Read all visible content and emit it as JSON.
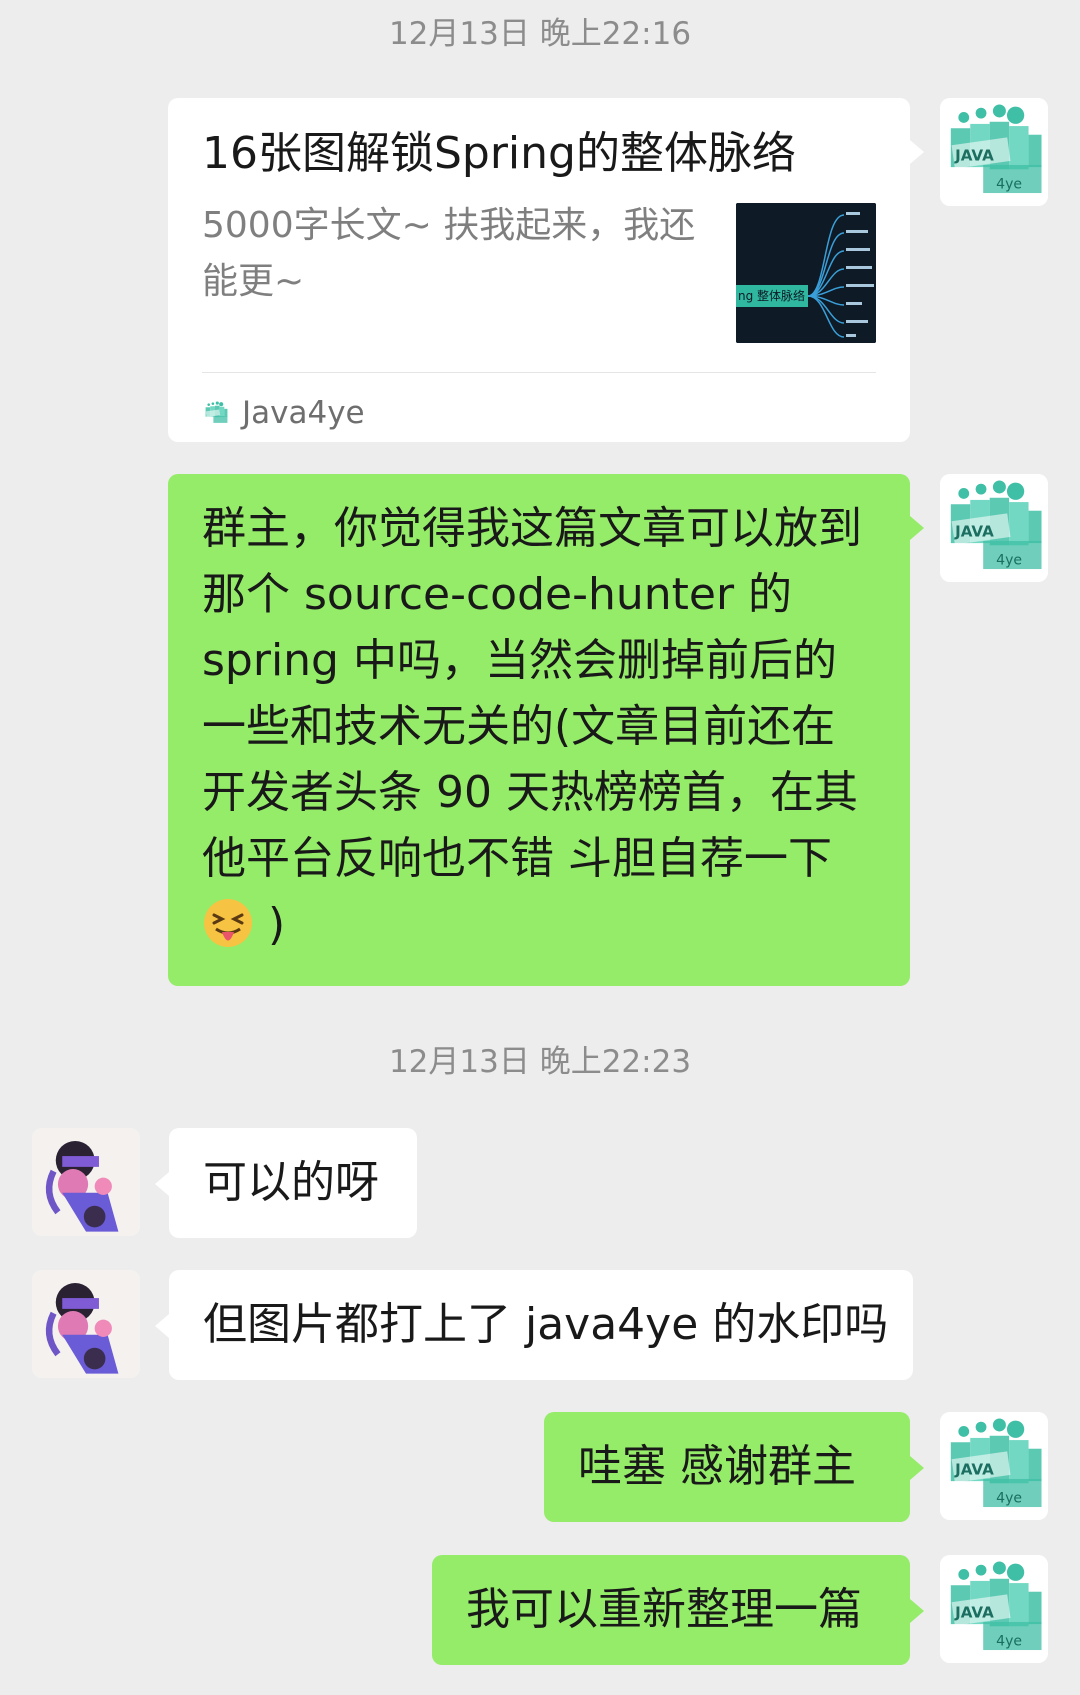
{
  "timestamps": [
    "12月13日 晚上22:16",
    "12月13日 晚上22:23"
  ],
  "link_card": {
    "title": "16张图解锁Spring的整体脉络",
    "description": "5000字长文~ 扶我起来，我还能更~",
    "thumbnail_label": "ng 整体脉络",
    "source": "Java4ye"
  },
  "self_avatar_text": {
    "line1": "JAVA",
    "line2": "4ye"
  },
  "messages": [
    {
      "sender": "self",
      "text_before_emoji": "群主，你觉得我这篇文章可以放到那个 source-code-hunter 的 spring 中吗，当然会删掉前后的一些和技术无关的(文章目前还在开发者头条 90 天热榜榜首，在其他平台反响也不错 斗胆自荐一下",
      "emoji": "squinting-tongue-face",
      "text_after_emoji": " )"
    },
    {
      "sender": "other",
      "text": "可以的呀"
    },
    {
      "sender": "other",
      "text": "但图片都打上了 java4ye 的水印吗"
    },
    {
      "sender": "self",
      "text": "哇塞 感谢群主"
    },
    {
      "sender": "self",
      "text": "我可以重新整理一篇"
    }
  ],
  "colors": {
    "background": "#ededed",
    "self_bubble": "#95ec69",
    "other_bubble": "#ffffff",
    "timestamp_text": "#8c8c8c",
    "avatar_teal": "#3fbfa6"
  }
}
